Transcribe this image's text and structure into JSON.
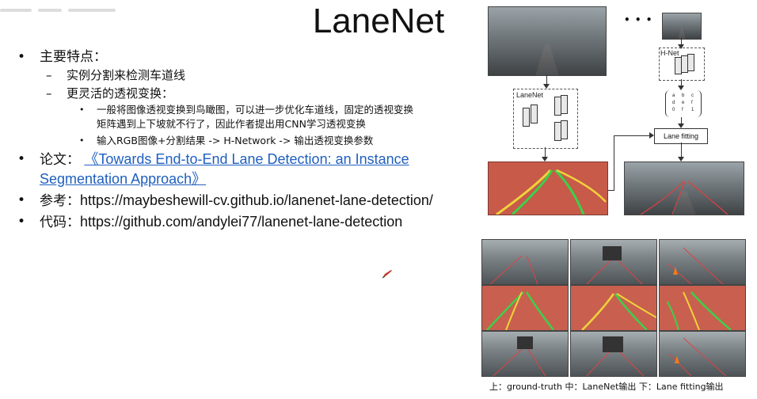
{
  "title": "LaneNet",
  "bullets": {
    "features": "主要特点：",
    "instance_seg": "实例分割来检测车道线",
    "persp_head": "更灵活的透视变换：",
    "persp_line1": "一般将图像透视变换到鸟瞰图，可以进一步优化车道线，固定的透视变换",
    "persp_line2": "矩阵遇到上下坡就不行了，因此作者提出用CNN学习透视变换",
    "persp_line3": "输入RGB图像+分割结果 -> H-Network -> 输出透视变换参数",
    "paper_label": "论文：",
    "paper_title_1": "《Towards End-to-End Lane Detection: an Instance",
    "paper_title_2": "Segmentation Approach》",
    "ref_label": "参考：",
    "ref_url": "https://maybeshewill-cv.github.io/lanenet-lane-detection/",
    "code_label": "代码：",
    "code_url": "https://github.com/andylei77/lanenet-lane-detection"
  },
  "diagram": {
    "lanenet_label": "LaneNet",
    "hnet_label": "H-Net",
    "ellipsis": "• • •",
    "fit_label": "Lane fitting",
    "matrix_col1": "a\nd\n0",
    "matrix_col2": "b\ne\nf",
    "matrix_col3": "c\nf\n1"
  },
  "caption": "上：ground-truth  中：LaneNet输出 下：Lane fitting输出",
  "colors": {
    "link": "#1f5fbf",
    "seg_red": "#c85a4a",
    "lane_green": "#3bd14a",
    "lane_yellow": "#f0d23a"
  }
}
